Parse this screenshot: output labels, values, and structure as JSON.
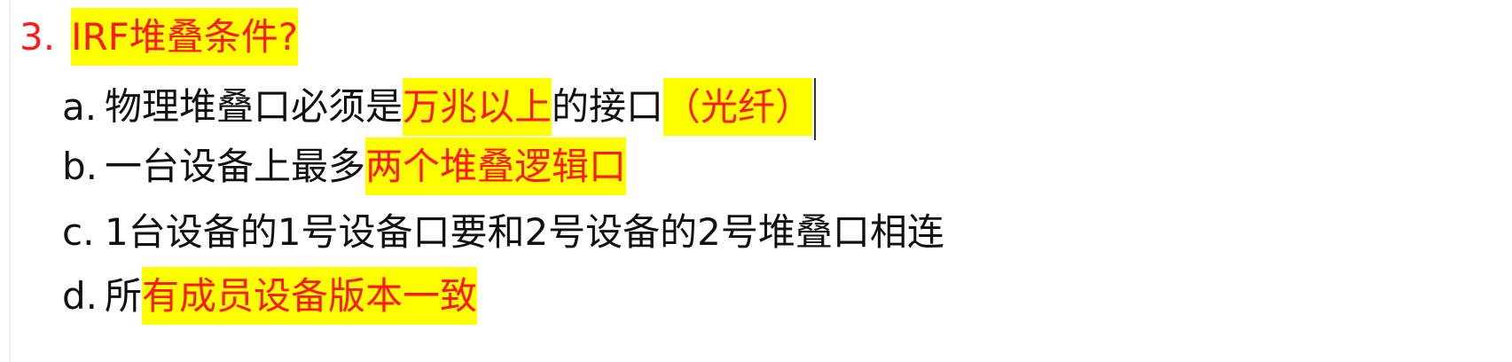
{
  "heading": {
    "number": "3.",
    "title": "IRF堆叠条件?"
  },
  "items": [
    {
      "marker": "a.",
      "parts": [
        "物理堆叠口必须是",
        "万兆以上",
        "的接口",
        "（光纤）"
      ]
    },
    {
      "marker": "b.",
      "parts": [
        "一台设备上最多",
        "两个堆叠逻辑口"
      ]
    },
    {
      "marker": "c.",
      "parts": [
        "1台设备的1号设备口要和2号设备的2号堆叠口相连"
      ]
    },
    {
      "marker": "d.",
      "parts": [
        "所",
        "有成员设备版本一致"
      ]
    }
  ],
  "colors": {
    "highlight": "#ffff00",
    "emphasis": "#ff1a1a",
    "text": "#111111"
  }
}
